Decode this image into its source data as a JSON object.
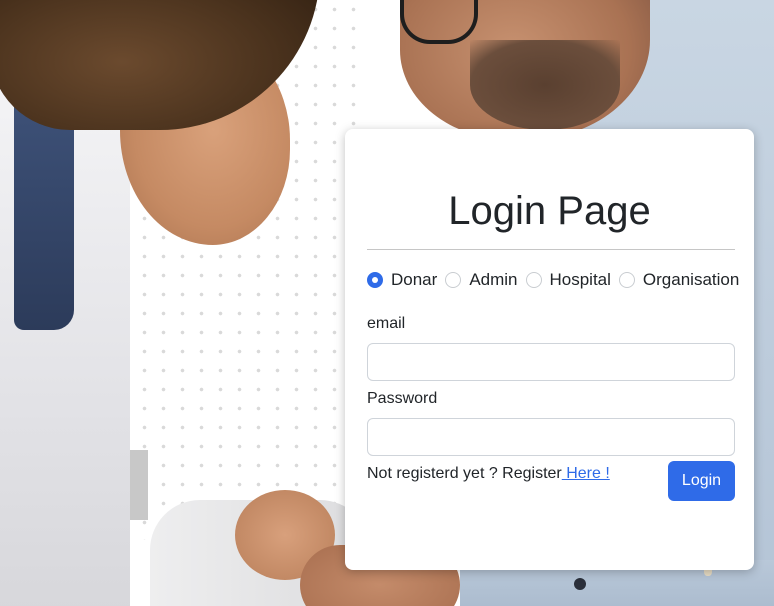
{
  "login": {
    "title": "Login Page",
    "roles": [
      {
        "label": "Donar",
        "checked": true
      },
      {
        "label": "Admin",
        "checked": false
      },
      {
        "label": "Hospital",
        "checked": false
      },
      {
        "label": "Organisation",
        "checked": false
      }
    ],
    "email_label": "email",
    "email_value": "",
    "password_label": "Password",
    "password_value": "",
    "register_prefix": "Not registerd yet ? Register",
    "register_link": " Here !",
    "login_button": "Login"
  },
  "colors": {
    "primary": "#2f6be8",
    "text": "#212529",
    "card_bg": "#ffffff"
  }
}
